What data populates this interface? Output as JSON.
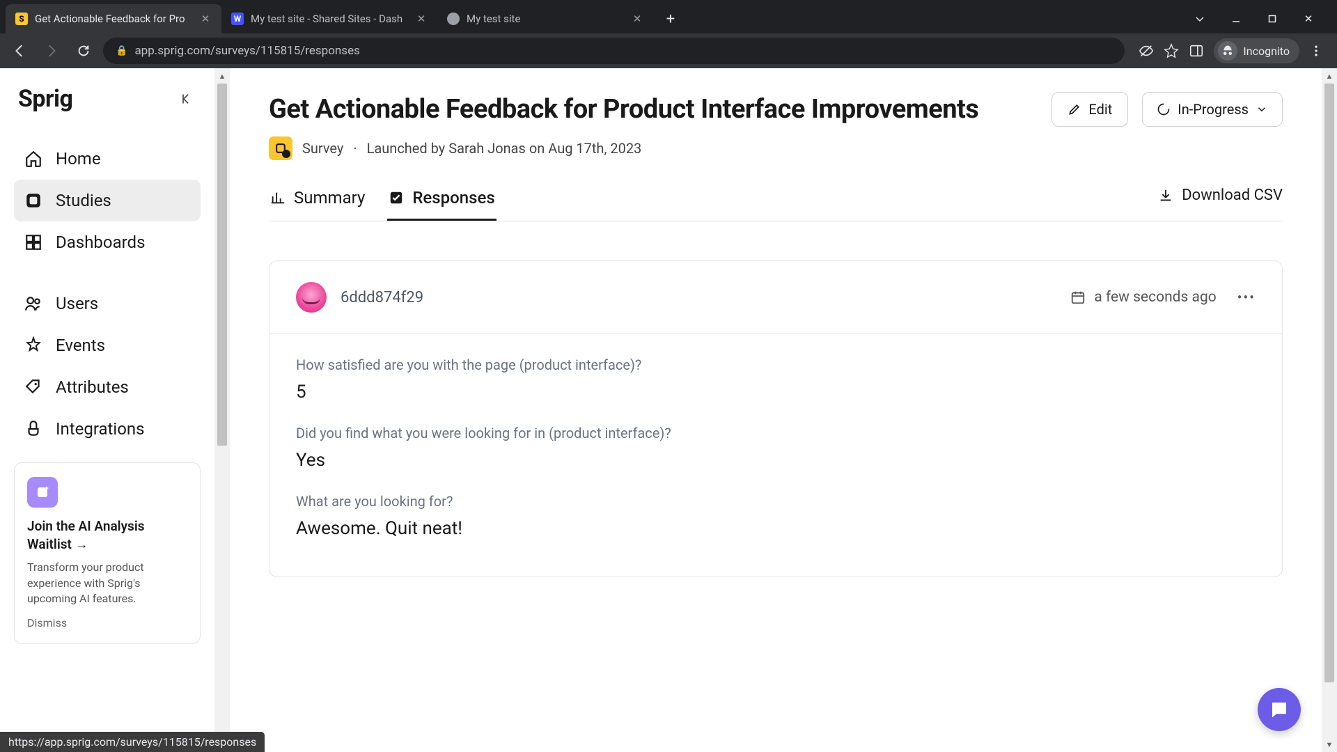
{
  "browser": {
    "tabs": [
      {
        "title": "Get Actionable Feedback for Pro",
        "active": true,
        "favicon": "sprig"
      },
      {
        "title": "My test site - Shared Sites - Dash",
        "active": false,
        "favicon": "webflow"
      },
      {
        "title": "My test site",
        "active": false,
        "favicon": "globe"
      }
    ],
    "url": "app.sprig.com/surveys/115815/responses",
    "profile_label": "Incognito",
    "hover_url": "https://app.sprig.com/surveys/115815/responses"
  },
  "sidebar": {
    "logo": "Sprig",
    "items": [
      {
        "label": "Home",
        "icon": "home"
      },
      {
        "label": "Studies",
        "icon": "studies",
        "active": true
      },
      {
        "label": "Dashboards",
        "icon": "dashboards"
      }
    ],
    "items2": [
      {
        "label": "Users",
        "icon": "users"
      },
      {
        "label": "Events",
        "icon": "events"
      },
      {
        "label": "Attributes",
        "icon": "attributes"
      },
      {
        "label": "Integrations",
        "icon": "integrations"
      }
    ],
    "promo": {
      "title": "Join the AI Analysis Waitlist →",
      "body": "Transform your product experience with Sprig's upcoming AI features.",
      "dismiss": "Dismiss"
    }
  },
  "header": {
    "title": "Get Actionable Feedback for Product Interface Improvements",
    "edit_label": "Edit",
    "status_label": "In-Progress",
    "meta_type": "Survey",
    "meta_text": "Launched by Sarah Jonas on Aug 17th, 2023"
  },
  "tabs": {
    "summary": "Summary",
    "responses": "Responses",
    "download": "Download CSV"
  },
  "response": {
    "id": "6ddd874f29",
    "time": "a few seconds ago",
    "qa": [
      {
        "q": "How satisfied are you with the page (product interface)?",
        "a": "5"
      },
      {
        "q": "Did you find what you were looking for in (product interface)?",
        "a": "Yes"
      },
      {
        "q": "What are you looking for?",
        "a": "Awesome. Quit neat!"
      }
    ]
  }
}
